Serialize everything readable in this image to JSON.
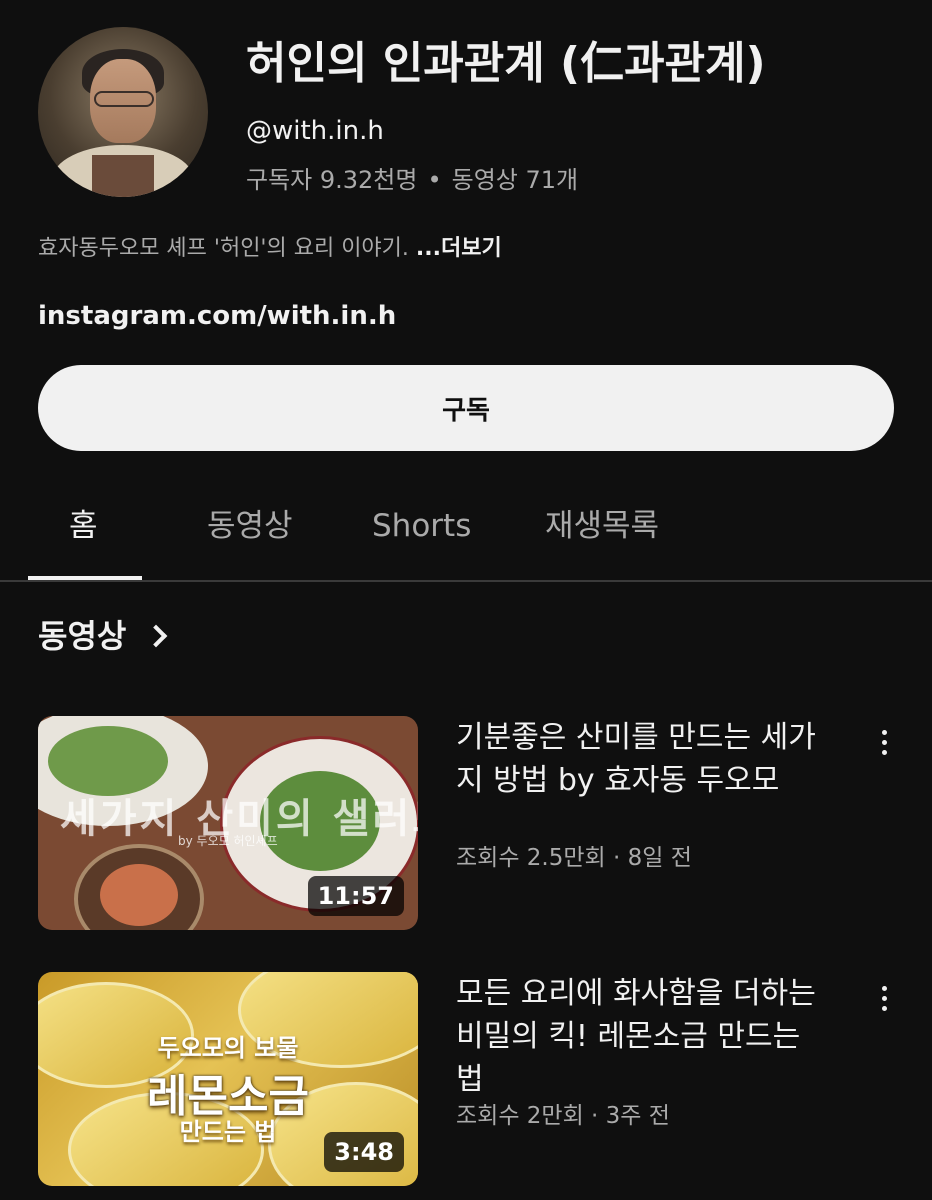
{
  "channel": {
    "name": "허인의 인과관계 (仁과관계)",
    "handle": "@with.in.h",
    "subscribers": "구독자 9.32천명",
    "separator": "•",
    "video_count": "동영상 71개",
    "description": "효자동두오모 셰프 '허인'의 요리 이야기. ",
    "more_label": "...더보기",
    "link": "instagram.com/with.in.h"
  },
  "subscribe_label": "구독",
  "tabs": [
    {
      "label": "홈",
      "active": true
    },
    {
      "label": "동영상",
      "active": false
    },
    {
      "label": "Shorts",
      "active": false
    },
    {
      "label": "재생목록",
      "active": false
    }
  ],
  "section": {
    "title": "동영상"
  },
  "videos": [
    {
      "title": "기분좋은 산미를 만드는 세가지 방법  by 효자동 두오모",
      "meta": "조회수 2.5만회 · 8일 전",
      "duration": "11:57",
      "thumb_caption": "세가지 산미의 샐러드",
      "thumb_sub": "by 두오모 허인셰프"
    },
    {
      "title": "모든 요리에 화사함을 더하는 비밀의 킥! 레몬소금 만드는 법",
      "meta": "조회수 2만회 · 3주 전",
      "duration": "3:48",
      "thumb_line1": "두오모의 보물",
      "thumb_line2": "레몬소금",
      "thumb_line3": "만드는 법"
    }
  ],
  "colors": {
    "background": "#0f0f0f",
    "text_primary": "#f1f1f1",
    "text_secondary": "#aaaaaa",
    "subscribe_bg": "#f1f1f1"
  }
}
